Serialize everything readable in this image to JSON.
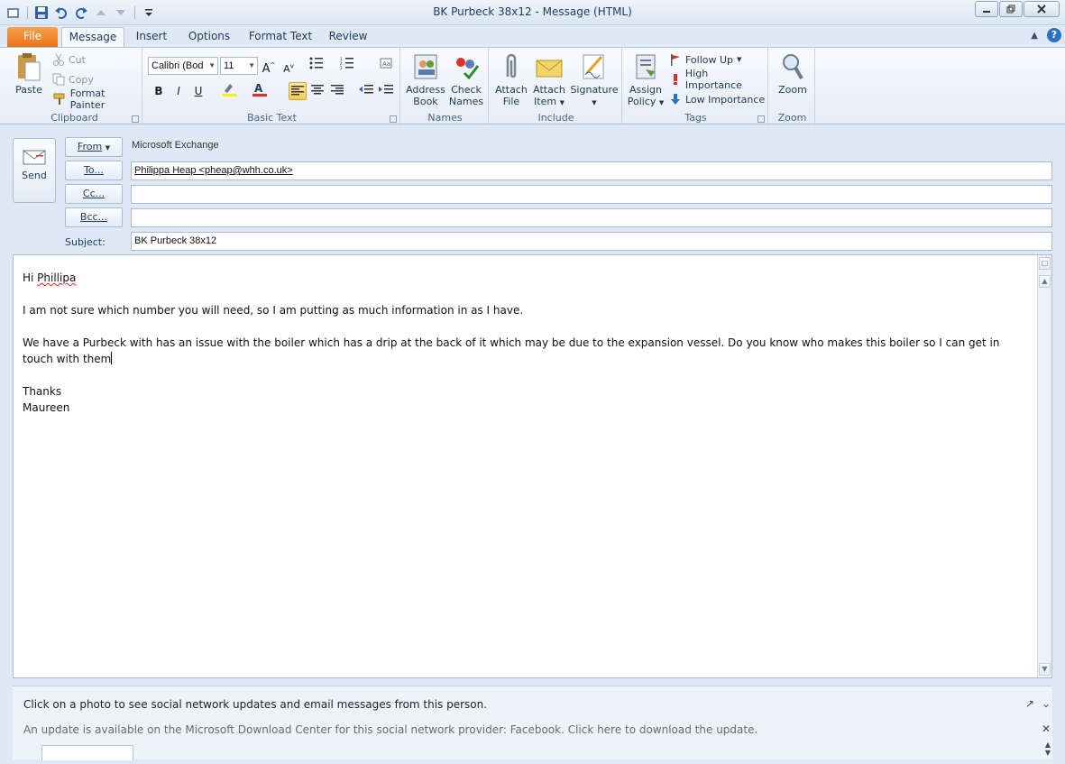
{
  "window": {
    "title": "BK  Purbeck 38x12  -  Message (HTML)"
  },
  "tabs": [
    {
      "label": "File"
    },
    {
      "label": "Message"
    },
    {
      "label": "Insert"
    },
    {
      "label": "Options"
    },
    {
      "label": "Format Text"
    },
    {
      "label": "Review"
    }
  ],
  "ribbon": {
    "clipboard": {
      "label": "Clipboard",
      "paste": "Paste",
      "cut": "Cut",
      "copy": "Copy",
      "format_painter": "Format Painter"
    },
    "basic_text": {
      "label": "Basic Text",
      "font_name": "Calibri (Bod",
      "font_size": "11",
      "bold": "B",
      "italic": "I",
      "underline": "U"
    },
    "names": {
      "label": "Names",
      "address_book_1": "Address",
      "address_book_2": "Book",
      "check_names_1": "Check",
      "check_names_2": "Names"
    },
    "include": {
      "label": "Include",
      "attach_file_1": "Attach",
      "attach_file_2": "File",
      "attach_item_1": "Attach",
      "attach_item_2": "Item",
      "signature": "Signature"
    },
    "tags": {
      "label": "Tags",
      "assign_policy_1": "Assign",
      "assign_policy_2": "Policy",
      "follow_up": "Follow Up",
      "high_importance": "High Importance",
      "low_importance": "Low Importance"
    },
    "zoom": {
      "label": "Zoom",
      "zoom_btn": "Zoom"
    }
  },
  "header": {
    "send": "Send",
    "from_label": "From",
    "from_value": "Microsoft Exchange",
    "to_label": "To...",
    "to_value": "Philippa Heap <pheap@whh.co.uk>",
    "cc_label": "Cc...",
    "cc_value": "",
    "bcc_label": "Bcc...",
    "bcc_value": "",
    "subject_label": "Subject:",
    "subject_value": "BK  Purbeck 38x12"
  },
  "body": {
    "greeting_prefix": "Hi ",
    "greeting_name": "Phillipa",
    "para1": "I am not sure which number you will need, so I am putting as much information in as I have.",
    "para2": "We have a Purbeck with has an issue with the boiler which has a drip at the back of it which may be due to the expansion vessel.  Do you know who makes this boiler so I can get in touch with them",
    "closing": "Thanks",
    "signature": "Maureen"
  },
  "people_pane": {
    "message": "Click on a photo to see social network updates and email messages from this person.",
    "update_notice": "An update is available on the Microsoft Download Center for this social network provider: Facebook. Click here to download the update."
  },
  "colors": {
    "file_tab": "#e8731a",
    "accent": "#2d6fc2",
    "high_importance": "#d9342b",
    "low_importance": "#2d6fc2"
  }
}
